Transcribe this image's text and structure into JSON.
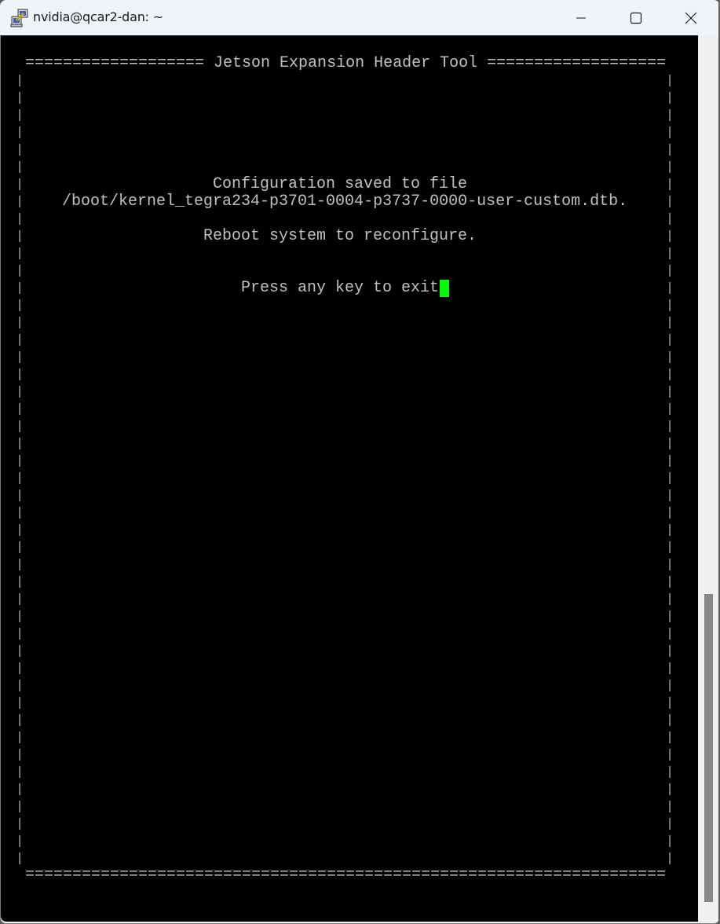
{
  "window": {
    "title": "nvidia@qcar2-dan: ~",
    "icon": "putty-icon",
    "controls": {
      "minimize_icon": "minimize-icon",
      "maximize_icon": "maximize-icon",
      "close_icon": "close-icon"
    }
  },
  "terminal": {
    "header_line": "=================== Jetson Expansion Header Tool ===================",
    "footer_line": "====================================================================",
    "messages": {
      "line1": "Configuration saved to file",
      "line2": "/boot/kernel_tegra234-p3701-0004-p3737-0000-user-custom.dtb.",
      "line3": "Reboot system to reconfigure.",
      "line4": "Press any key to exit"
    },
    "colors": {
      "background": "#000000",
      "foreground": "#c0c0c0",
      "cursor": "#00ff00"
    }
  },
  "scrollbar": {
    "position": "bottom"
  }
}
